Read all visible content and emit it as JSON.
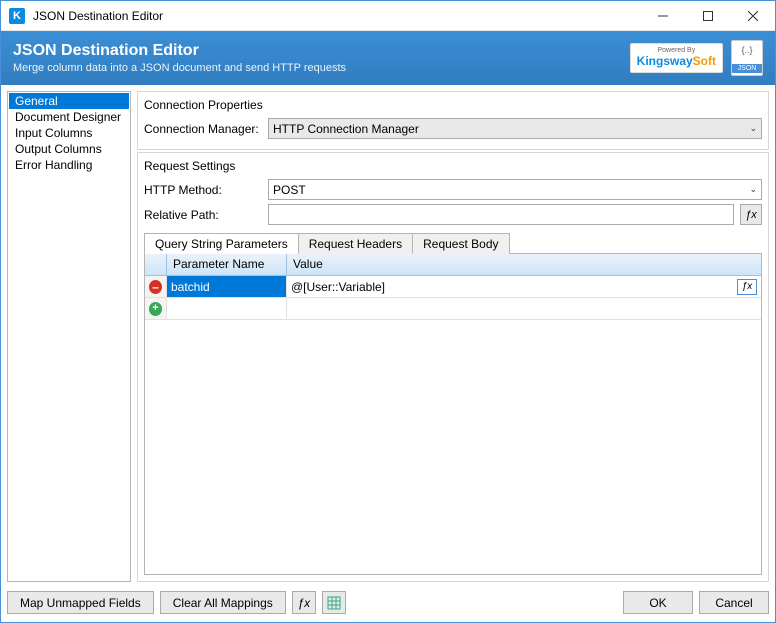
{
  "window": {
    "title": "JSON Destination Editor"
  },
  "header": {
    "title": "JSON Destination Editor",
    "subtitle": "Merge column data into a JSON document and send HTTP requests",
    "poweredBy": "Powered By",
    "brandK": "Kingsway",
    "brandS": "Soft"
  },
  "sidebar": {
    "items": [
      "General",
      "Document Designer",
      "Input Columns",
      "Output Columns",
      "Error Handling"
    ]
  },
  "connection": {
    "groupTitle": "Connection Properties",
    "managerLabel": "Connection Manager:",
    "managerValue": "HTTP Connection Manager"
  },
  "request": {
    "groupTitle": "Request Settings",
    "methodLabel": "HTTP Method:",
    "methodValue": "POST",
    "pathLabel": "Relative Path:",
    "pathValue": ""
  },
  "tabs": {
    "qsp": "Query String Parameters",
    "headers": "Request Headers",
    "body": "Request Body"
  },
  "grid": {
    "colName": "Parameter Name",
    "colValue": "Value",
    "rows": [
      {
        "name": "batchid",
        "value": "@[User::Variable]"
      }
    ]
  },
  "footer": {
    "mapUnmapped": "Map Unmapped Fields",
    "clearAll": "Clear All Mappings",
    "ok": "OK",
    "cancel": "Cancel"
  }
}
